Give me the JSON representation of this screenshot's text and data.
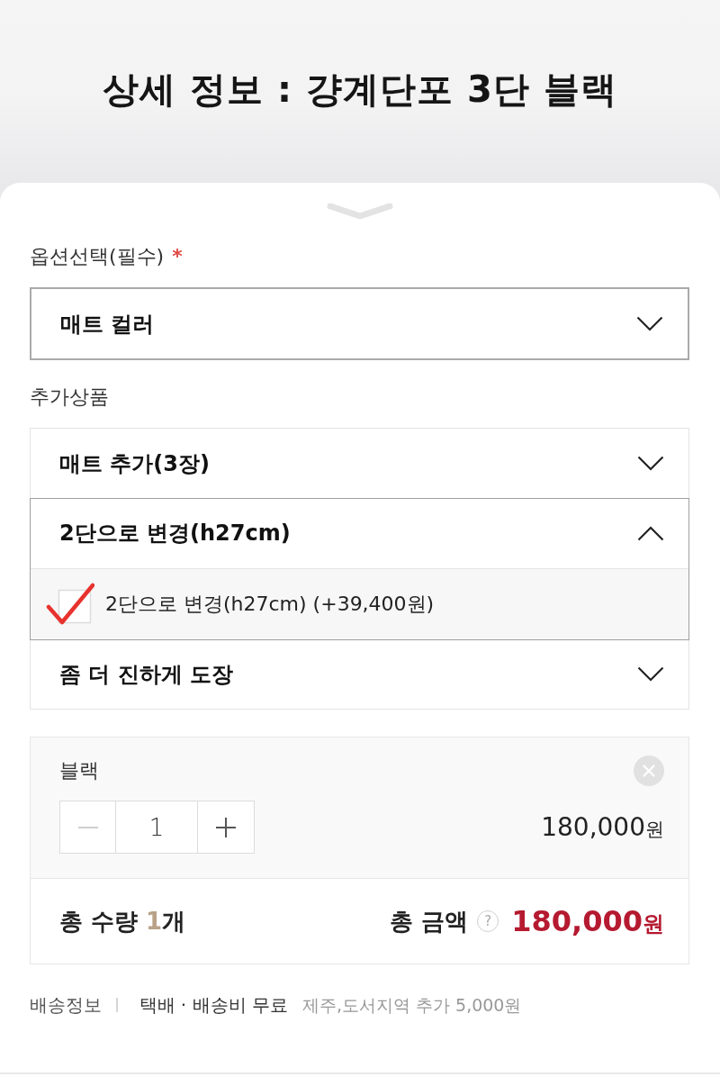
{
  "header": {
    "title": "상세 정보 : 걍계단포 3단 블랙"
  },
  "option": {
    "label": "옵션선택(필수)",
    "required_mark": "*",
    "select": {
      "value": "매트 컬러",
      "expanded": false
    }
  },
  "addons": {
    "label": "추가상품",
    "items": [
      {
        "title": "매트 추가(3장)",
        "expanded": false
      },
      {
        "title": "2단으로 변경(h27cm)",
        "expanded": true,
        "options": [
          {
            "label": "2단으로 변경(h27cm) (+39,400원)",
            "checked": true
          }
        ]
      },
      {
        "title": "좀 더 진하게 도장",
        "expanded": false
      }
    ]
  },
  "selected_items": [
    {
      "name": "블랙",
      "decrease_disabled": true,
      "quantity": "1",
      "price": "180,000",
      "currency": "원"
    }
  ],
  "total": {
    "quantity_label": "총 수량",
    "quantity": "1",
    "quantity_unit": "개",
    "amount_label": "총 금액",
    "help": "?",
    "amount": "180,000",
    "currency": "원"
  },
  "shipping": {
    "label": "배송정보",
    "method": "택배 · 배송비 무료",
    "note": "제주,도서지역 추가 5,000원"
  }
}
